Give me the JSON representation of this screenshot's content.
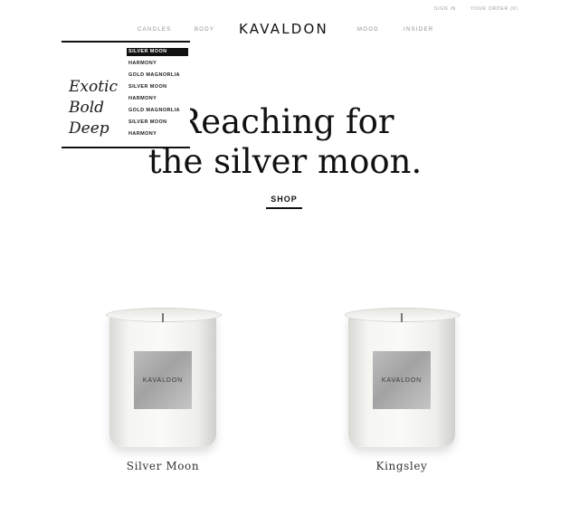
{
  "header": {
    "util_links": [
      "SIGN IN",
      "YOUR ORDER (0)"
    ],
    "nav_left": [
      "CANDLES",
      "BODY"
    ],
    "logo": "KAVALDON",
    "nav_right": [
      "MOOD",
      "INSIDER"
    ]
  },
  "dropdown": {
    "mood_words": [
      "Exotic",
      "Bold",
      "Deep"
    ],
    "items": [
      "SILVER MOON",
      "HARMONY",
      "GOLD MAGNORLIA",
      "SILVER MOON",
      "HARMONY",
      "GOLD MAGNORLIA",
      "SILVER MOON",
      "HARMONY"
    ],
    "active_index": 0
  },
  "hero": {
    "title_line1": "Reaching for",
    "title_line2": "the silver moon.",
    "shop_label": "SHOP"
  },
  "products": [
    {
      "name": "Silver Moon",
      "label_brand": "KAVALDON"
    },
    {
      "name": "Kingsley",
      "label_brand": "KAVALDON"
    }
  ]
}
